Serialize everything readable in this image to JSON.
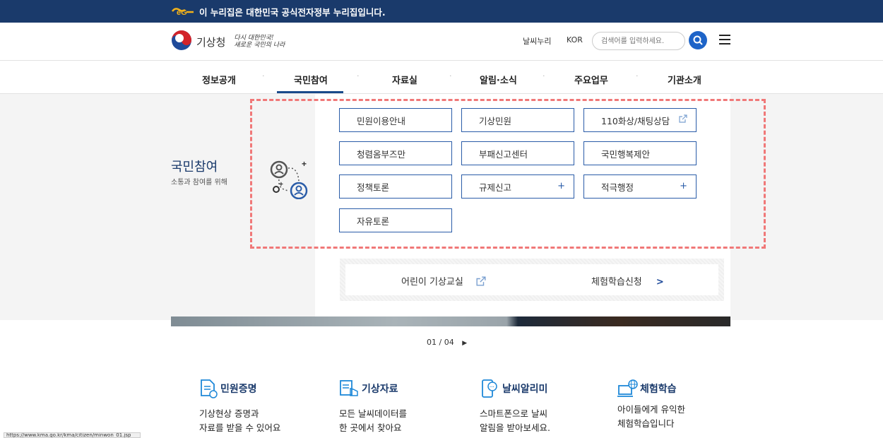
{
  "topbar": {
    "notice": "이 누리집은 대한민국 공식전자정부 누리집입니다."
  },
  "header": {
    "logo_name": "기상청",
    "slogan_line1": "다시 대한민국!",
    "slogan_line2": "새로운 국민의 나라",
    "util_weather": "날씨누리",
    "util_lang": "KOR",
    "search_placeholder": "검색어를 입력하세요."
  },
  "gnb": {
    "items": [
      "정보공개",
      "국민참여",
      "자료실",
      "알림·소식",
      "주요업무",
      "기관소개"
    ],
    "active": "국민참여"
  },
  "section": {
    "title": "국민참여",
    "subtitle": "소통과 참여를 위해"
  },
  "buttons": [
    {
      "label": "민원이용안내",
      "trail": ""
    },
    {
      "label": "기상민원",
      "trail": ""
    },
    {
      "label": "110화상/채팅상담",
      "trail": "external-link-icon"
    },
    {
      "label": "청렴옴부즈만",
      "trail": ""
    },
    {
      "label": "부패신고센터",
      "trail": ""
    },
    {
      "label": "국민행복제안",
      "trail": ""
    },
    {
      "label": "정책토론",
      "trail": ""
    },
    {
      "label": "규제신고",
      "trail": "+"
    },
    {
      "label": "적극행정",
      "trail": "+"
    },
    {
      "label": "자유토론",
      "trail": ""
    }
  ],
  "sub_links": {
    "kids": "어린이 기상교실",
    "experience": "체험학습신청"
  },
  "pager": {
    "text": "01 / 04"
  },
  "features": [
    {
      "title": "민원증명",
      "desc1": "기상현상 증명과",
      "desc2": "자료를 받을 수 있어요"
    },
    {
      "title": "기상자료",
      "desc1": "모든 날씨데이터를",
      "desc2": "한 곳에서 찾아요"
    },
    {
      "title": "날씨알리미",
      "desc1": "스마트폰으로 날씨",
      "desc2": "알림을 받아보세요."
    },
    {
      "title": "체험학습",
      "desc1": "아이들에게 유익한",
      "desc2": "체험학습입니다"
    }
  ],
  "status_url": "https://www.kma.go.kr/kma/citizen/minwon_01.jsp",
  "colors": {
    "navy": "#1a3a6b",
    "accent": "#2a5ca8",
    "highlight": "#f07878"
  }
}
